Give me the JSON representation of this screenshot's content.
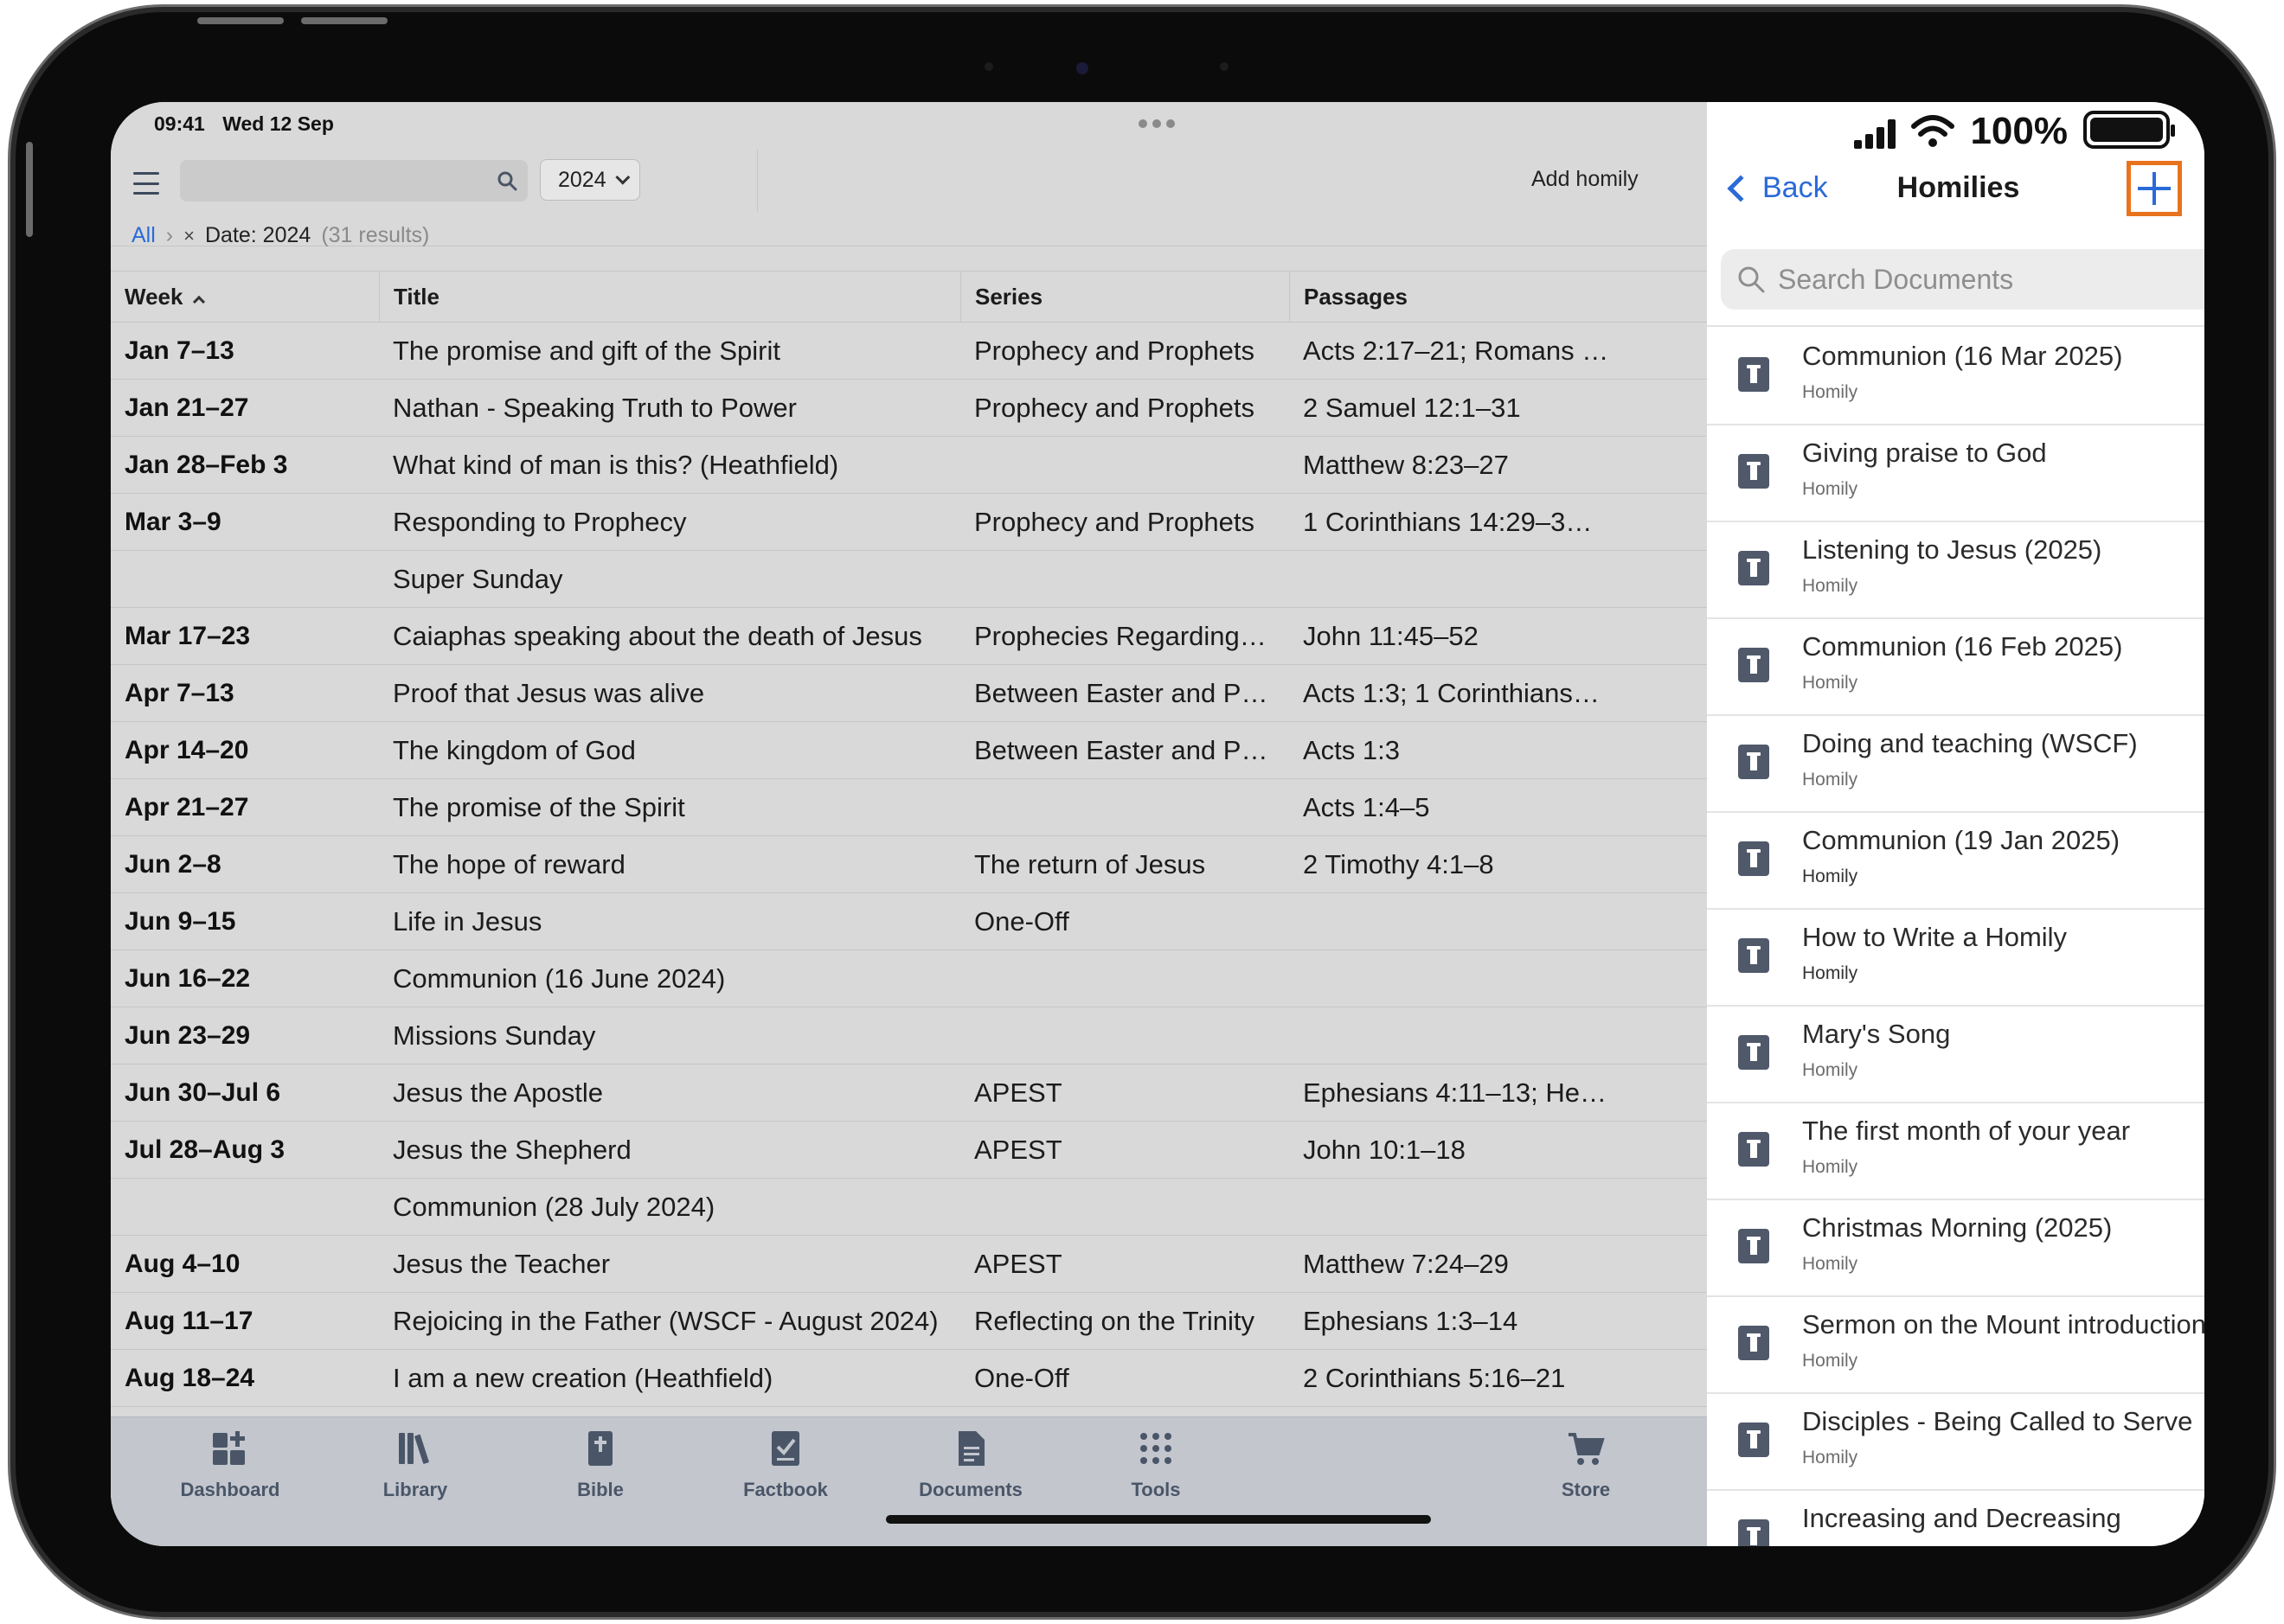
{
  "status": {
    "time": "09:41",
    "date": "Wed 12 Sep",
    "battery": "100%"
  },
  "toolbar": {
    "year": "2024",
    "add_homily": "Add homily"
  },
  "breadcrumb": {
    "all": "All",
    "separator": "›",
    "remove": "×",
    "filter": "Date: 2024",
    "count": "(31 results)"
  },
  "table": {
    "headers": {
      "week": "Week",
      "title": "Title",
      "series": "Series",
      "passages": "Passages"
    },
    "rows": [
      {
        "week": "Jan 7–13",
        "title": "The promise and gift of the Spirit",
        "series": "Prophecy and Prophets",
        "passages": "Acts 2:17–21; Romans …"
      },
      {
        "week": "Jan 21–27",
        "title": "Nathan - Speaking Truth to Power",
        "series": "Prophecy and Prophets",
        "passages": "2 Samuel 12:1–31"
      },
      {
        "week": "Jan 28–Feb 3",
        "title": "What kind of man is this? (Heathfield)",
        "series": "",
        "passages": "Matthew 8:23–27"
      },
      {
        "week": "Mar 3–9",
        "title": "Responding to Prophecy",
        "series": "Prophecy and Prophets",
        "passages": "1 Corinthians 14:29–3…"
      },
      {
        "week": "",
        "title": "Super Sunday",
        "series": "",
        "passages": ""
      },
      {
        "week": "Mar 17–23",
        "title": "Caiaphas speaking about the death of Jesus",
        "series": "Prophecies Regarding…",
        "passages": "John 11:45–52"
      },
      {
        "week": "Apr 7–13",
        "title": "Proof that Jesus was alive",
        "series": "Between Easter and P…",
        "passages": "Acts 1:3; 1 Corinthians…"
      },
      {
        "week": "Apr 14–20",
        "title": "The kingdom of God",
        "series": "Between Easter and P…",
        "passages": "Acts 1:3"
      },
      {
        "week": "Apr 21–27",
        "title": "The promise of the Spirit",
        "series": "",
        "passages": "Acts 1:4–5"
      },
      {
        "week": "Jun 2–8",
        "title": "The hope of reward",
        "series": "The return of Jesus",
        "passages": "2 Timothy 4:1–8"
      },
      {
        "week": "Jun 9–15",
        "title": "Life in Jesus",
        "series": "One-Off",
        "passages": ""
      },
      {
        "week": "Jun 16–22",
        "title": "Communion (16 June 2024)",
        "series": "",
        "passages": ""
      },
      {
        "week": "Jun 23–29",
        "title": "Missions Sunday",
        "series": "",
        "passages": ""
      },
      {
        "week": "Jun 30–Jul 6",
        "title": "Jesus the Apostle",
        "series": "APEST",
        "passages": "Ephesians 4:11–13; He…"
      },
      {
        "week": "Jul 28–Aug 3",
        "title": "Jesus the Shepherd",
        "series": "APEST",
        "passages": "John 10:1–18"
      },
      {
        "week": "",
        "title": "Communion (28 July 2024)",
        "series": "",
        "passages": ""
      },
      {
        "week": "Aug 4–10",
        "title": "Jesus the Teacher",
        "series": "APEST",
        "passages": "Matthew 7:24–29"
      },
      {
        "week": "Aug 11–17",
        "title": "Rejoicing in the Father (WSCF - August 2024)",
        "series": "Reflecting on the Trinity",
        "passages": "Ephesians 1:3–14"
      },
      {
        "week": "Aug 18–24",
        "title": "I am a new creation (Heathfield)",
        "series": "One-Off",
        "passages": "2 Corinthians 5:16–21"
      }
    ]
  },
  "tabbar": [
    {
      "label": "Dashboard",
      "icon": "dashboard-icon"
    },
    {
      "label": "Library",
      "icon": "library-icon"
    },
    {
      "label": "Bible",
      "icon": "bible-icon"
    },
    {
      "label": "Factbook",
      "icon": "factbook-icon"
    },
    {
      "label": "Documents",
      "icon": "documents-icon"
    },
    {
      "label": "Tools",
      "icon": "tools-icon"
    },
    {
      "label": "Store",
      "icon": "store-icon"
    }
  ],
  "panel": {
    "back": "Back",
    "title": "Homilies",
    "search_placeholder": "Search Documents",
    "add_highlight_color": "#e8731d",
    "accent_color": "#2a6ad8",
    "documents": [
      {
        "title": "Communion (16 Mar 2025)",
        "type": "Homily"
      },
      {
        "title": "Giving praise to God",
        "type": "Homily"
      },
      {
        "title": "Listening to Jesus (2025)",
        "type": "Homily"
      },
      {
        "title": "Communion (16 Feb 2025)",
        "type": "Homily"
      },
      {
        "title": "Doing and teaching (WSCF)",
        "type": "Homily"
      },
      {
        "title": "Communion (19 Jan 2025)",
        "type": "Homily"
      },
      {
        "title": "How to Write a Homily",
        "type": "Homily"
      },
      {
        "title": "Mary's Song",
        "type": "Homily"
      },
      {
        "title": "The first month of your year",
        "type": "Homily"
      },
      {
        "title": "Christmas Morning (2025)",
        "type": "Homily"
      },
      {
        "title": "Sermon on the Mount introduction",
        "type": "Homily"
      },
      {
        "title": "Disciples - Being Called to Serve",
        "type": "Homily"
      },
      {
        "title": "Increasing and Decreasing",
        "type": ""
      }
    ]
  }
}
